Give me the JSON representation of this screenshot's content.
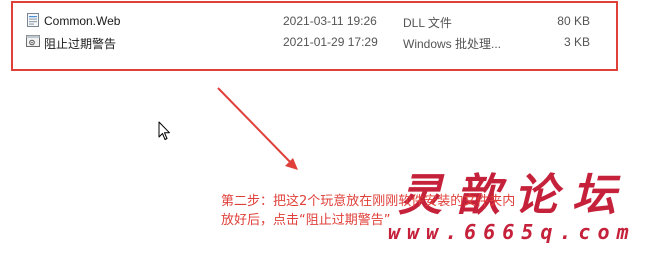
{
  "files": [
    {
      "name": "Common.Web",
      "modified": "2021-03-11 19:26",
      "type": "DLL 文件",
      "size": "80 KB",
      "icon": "dll-file-icon"
    },
    {
      "name": "阻止过期警告",
      "modified": "2021-01-29 17:29",
      "type": "Windows 批处理...",
      "size": "3 KB",
      "icon": "batch-file-icon"
    }
  ],
  "annotation": {
    "line1": "第二步：把这2个玩意放在刚刚软件安装的文件夹内",
    "line2": "放好后，点击“阻止过期警告”"
  },
  "watermark": {
    "title": "灵歆论坛",
    "url": "www.6665q.com"
  },
  "colors": {
    "annotation_red": "#e0403a",
    "watermark_red": "#c5213a"
  }
}
